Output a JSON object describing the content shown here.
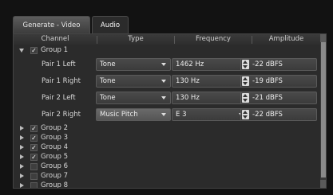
{
  "tabs": [
    {
      "label": "Generate - Video",
      "active": false
    },
    {
      "label": "Audio",
      "active": true
    }
  ],
  "table": {
    "headers": [
      "Channel",
      "Type",
      "Frequency",
      "Amplitude"
    ],
    "group1": {
      "label": "Group 1",
      "checked": true,
      "expanded": true
    },
    "pairs": [
      {
        "name": "Pair 1 Left",
        "type": "Tone",
        "frequency": "1462 Hz",
        "amplitude": "-22 dBFS"
      },
      {
        "name": "Pair 1 Right",
        "type": "Tone",
        "frequency": "130 Hz",
        "amplitude": "-19 dBFS"
      },
      {
        "name": "Pair 2 Left",
        "type": "Tone",
        "frequency": "130 Hz",
        "amplitude": "-21 dBFS"
      },
      {
        "name": "Pair 2 Right",
        "type": "Music Pitch",
        "frequency": "E 3",
        "amplitude": "-22 dBFS"
      }
    ],
    "groups": [
      {
        "label": "Group 2",
        "checked": true
      },
      {
        "label": "Group 3",
        "checked": true
      },
      {
        "label": "Group 4",
        "checked": true
      },
      {
        "label": "Group 5",
        "checked": true
      },
      {
        "label": "Group 6",
        "checked": false
      },
      {
        "label": "Group 7",
        "checked": false
      },
      {
        "label": "Group 8",
        "checked": false
      }
    ]
  },
  "icons": {
    "check": "✓",
    "expand": "triangle-right-icon",
    "collapse": "triangle-down-icon",
    "spin": "up-down-arrows-icon"
  },
  "colors": {
    "background": "#121212",
    "panel": "#2b2b2b",
    "field": "#3f3f3f",
    "highlight": "#626262",
    "text": "#d8d8d8"
  }
}
